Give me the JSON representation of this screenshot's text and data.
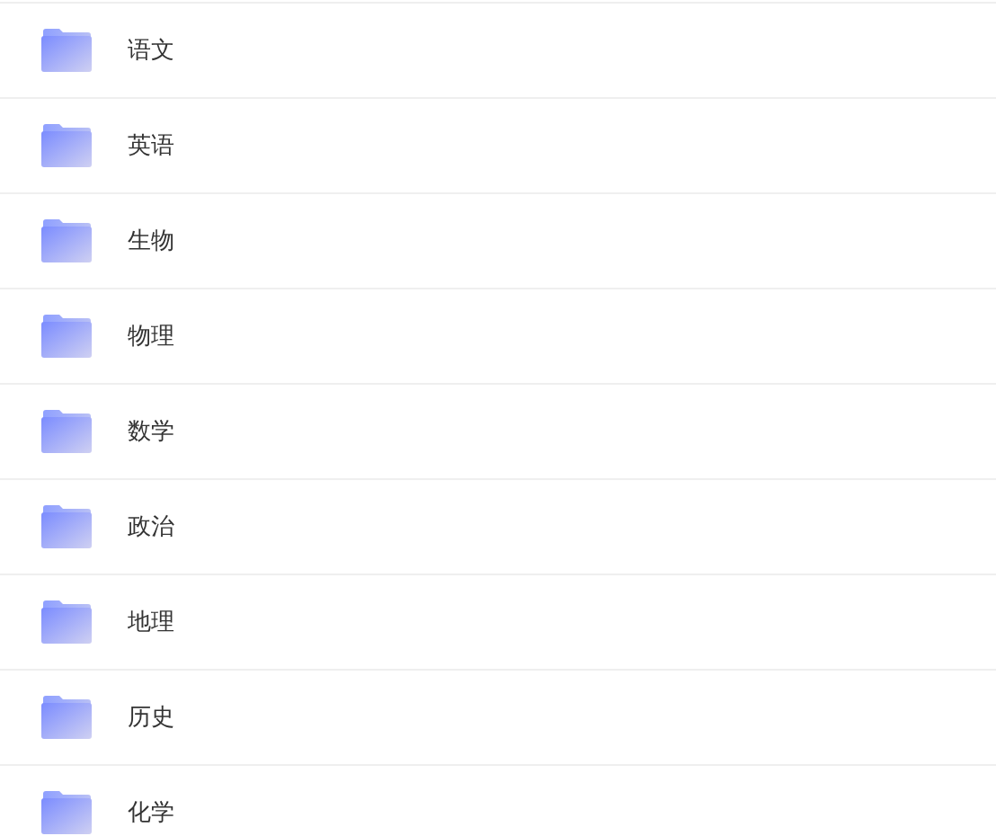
{
  "folders": [
    {
      "name": "语文"
    },
    {
      "name": "英语"
    },
    {
      "name": "生物"
    },
    {
      "name": "物理"
    },
    {
      "name": "数学"
    },
    {
      "name": "政治"
    },
    {
      "name": "地理"
    },
    {
      "name": "历史"
    },
    {
      "name": "化学"
    }
  ]
}
